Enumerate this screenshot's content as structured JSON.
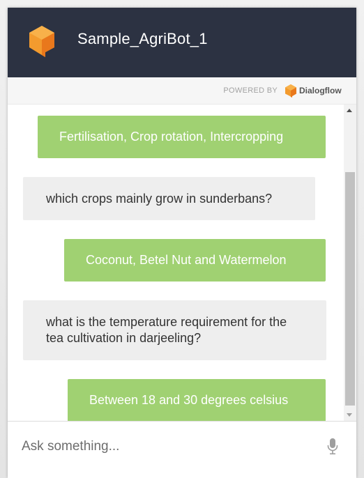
{
  "header": {
    "title": "Sample_AgriBot_1",
    "accent_color": "#f5871f",
    "background_color": "#2c3242"
  },
  "powered_by": {
    "label": "POWERED BY",
    "brand": "Dialogflow",
    "brand_icon": "dialogflow-logo-icon"
  },
  "conversation": [
    {
      "sender": "bot",
      "text": "Fertilisation, Crop rotation, Intercropping"
    },
    {
      "sender": "user",
      "text": "which crops mainly grow in sunderbans?"
    },
    {
      "sender": "bot",
      "text": "Coconut, Betel Nut and Watermelon"
    },
    {
      "sender": "user",
      "text": "what is the temperature requirement for the tea cultivation in darjeeling?"
    },
    {
      "sender": "bot",
      "text": "Between 18 and 30 degrees celsius"
    }
  ],
  "input": {
    "placeholder": "Ask something...",
    "value": "",
    "mic_icon": "microphone-icon"
  },
  "colors": {
    "bot_bubble": "#a0d172",
    "user_bubble": "#eeeeee"
  }
}
